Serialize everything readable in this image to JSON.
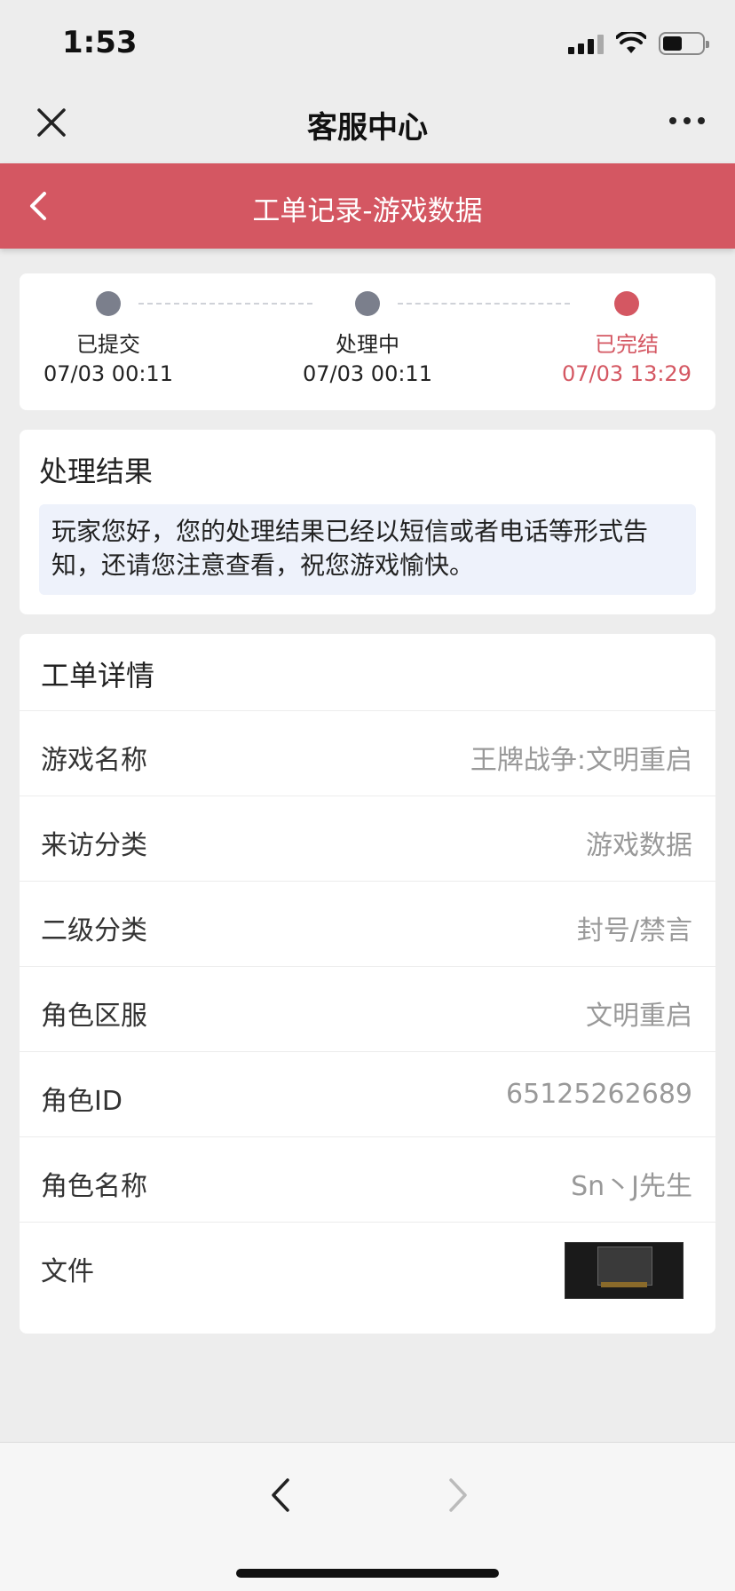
{
  "status_bar": {
    "time": "1:53",
    "icons": [
      "signal-icon",
      "wifi-icon",
      "battery-icon"
    ],
    "battery_level": 0.5
  },
  "nav": {
    "title": "客服中心",
    "close_icon": "close-icon",
    "more_icon": "more-icon"
  },
  "header": {
    "title": "工单记录-游戏数据",
    "back_icon": "chevron-left-icon",
    "color": "#d45762"
  },
  "progress": {
    "steps": [
      {
        "label": "已提交",
        "time": "07/03 00:11",
        "state": "done-grey"
      },
      {
        "label": "处理中",
        "time": "07/03 00:11",
        "state": "done-grey"
      },
      {
        "label": "已完结",
        "time": "07/03 13:29",
        "state": "current"
      }
    ],
    "active_color": "#d45762",
    "inactive_color": "#7b7f8c"
  },
  "result": {
    "heading": "处理结果",
    "message": "玩家您好，您的处理结果已经以短信或者电话等形式告知，还请您注意查看，祝您游戏愉快。"
  },
  "details": {
    "heading": "工单详情",
    "rows": [
      {
        "key": "游戏名称",
        "value": "王牌战争:文明重启"
      },
      {
        "key": "来访分类",
        "value": "游戏数据"
      },
      {
        "key": "二级分类",
        "value": "封号/禁言"
      },
      {
        "key": "角色区服",
        "value": "文明重启"
      },
      {
        "key": "角色ID",
        "value": "65125262689"
      },
      {
        "key": "角色名称",
        "value": "Sn丶J先生"
      }
    ],
    "file_label": "文件"
  },
  "toolbar": {
    "back_icon": "chevron-left-icon",
    "forward_icon": "chevron-right-icon"
  }
}
